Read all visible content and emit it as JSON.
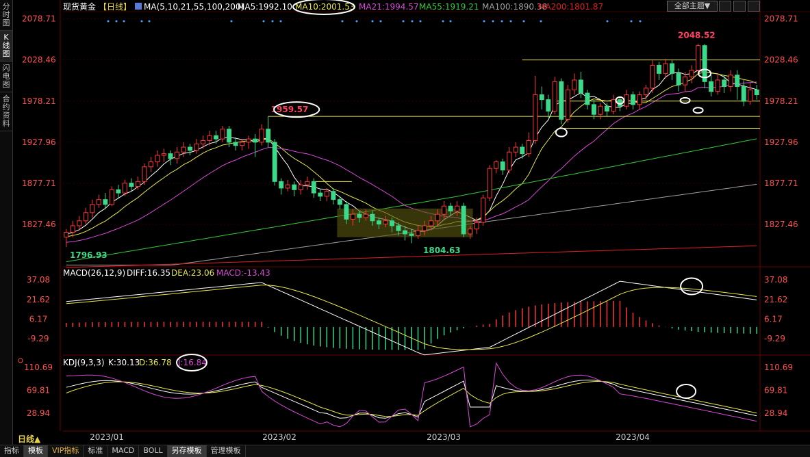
{
  "sidebar": {
    "tabs": [
      {
        "label": "分时图",
        "active": false
      },
      {
        "label": "K线图",
        "active": true
      },
      {
        "label": "闪电图",
        "active": false
      },
      {
        "label": "合约资料",
        "active": false
      }
    ]
  },
  "header": {
    "symbol": "现货黄金",
    "period_tag": "【日线】",
    "ma_params": "MA(5,10,21,55,100,200)",
    "ma5": "MA5:1992.10",
    "ma10": "MA10:2001.53",
    "ma21": "MA21:1994.57",
    "ma55": "MA55:1919.21",
    "ma100": "MA100:1890.38",
    "ma200": "MA200:1801.87",
    "theme_select": "全部主题▼"
  },
  "colors": {
    "up": "#ff3b3b",
    "down": "#3dd98a",
    "ma5": "#ffffff",
    "ma10": "#e8e84a",
    "ma21": "#d84ad8",
    "ma55": "#3ac83a",
    "ma100": "#a0a0a0",
    "ma200": "#e02020",
    "price_axis": "#ff5050",
    "grid": "#550000"
  },
  "price_axis": [
    "2078.71",
    "2028.46",
    "1978.21",
    "1927.96",
    "1877.71",
    "1827.46"
  ],
  "annotations": {
    "high_label": "2048.52",
    "peak_label": "1959.57",
    "low_label_1": "1796.93",
    "low_label_2": "1804.63"
  },
  "macd": {
    "title": "MACD(26,12,9)",
    "diff": "DIFF:16.35",
    "dea": "DEA:23.06",
    "macd": "MACD:-13.43",
    "axis": [
      "37.08",
      "21.62",
      "6.17",
      "-9.29"
    ]
  },
  "kdj": {
    "title": "KDJ(9,3,3)",
    "k": "K:30.13",
    "d": "D:36.78",
    "j": "J:16.84",
    "axis": [
      "110.69",
      "69.81",
      "28.94"
    ]
  },
  "x_axis": [
    "2023/01",
    "2023/02",
    "2023/03",
    "2023/04"
  ],
  "period_label": "日线▲",
  "toolbar": [
    {
      "label": "指标",
      "active": false,
      "vip": false
    },
    {
      "label": "模板",
      "active": true,
      "vip": false
    },
    {
      "label": "VIP指标",
      "active": false,
      "vip": true
    },
    {
      "label": "标准",
      "active": false,
      "vip": false
    },
    {
      "label": "MACD",
      "active": false,
      "vip": false
    },
    {
      "label": "BOLL",
      "active": false,
      "vip": false
    },
    {
      "label": "另存模板",
      "active": true,
      "vip": false
    },
    {
      "label": "管理模板",
      "active": false,
      "vip": false
    }
  ],
  "chart_data": {
    "type": "candlestick",
    "title": "现货黄金【日线】",
    "ylim": [
      1780,
      2085
    ],
    "x_labels": [
      "2023/01",
      "2023/02",
      "2023/03",
      "2023/04"
    ],
    "candles": [
      [
        1812,
        1818,
        1800,
        1822
      ],
      [
        1818,
        1826,
        1812,
        1832
      ],
      [
        1826,
        1832,
        1820,
        1838
      ],
      [
        1832,
        1842,
        1828,
        1848
      ],
      [
        1842,
        1852,
        1836,
        1858
      ],
      [
        1852,
        1858,
        1848,
        1864
      ],
      [
        1858,
        1852,
        1846,
        1866
      ],
      [
        1852,
        1870,
        1850,
        1874
      ],
      [
        1870,
        1866,
        1860,
        1876
      ],
      [
        1866,
        1878,
        1862,
        1882
      ],
      [
        1878,
        1874,
        1868,
        1884
      ],
      [
        1874,
        1880,
        1870,
        1886
      ],
      [
        1880,
        1898,
        1876,
        1902
      ],
      [
        1898,
        1904,
        1892,
        1910
      ],
      [
        1904,
        1912,
        1898,
        1918
      ],
      [
        1912,
        1914,
        1904,
        1920
      ],
      [
        1914,
        1908,
        1900,
        1918
      ],
      [
        1908,
        1916,
        1902,
        1922
      ],
      [
        1916,
        1922,
        1910,
        1928
      ],
      [
        1922,
        1918,
        1912,
        1926
      ],
      [
        1918,
        1926,
        1914,
        1932
      ],
      [
        1926,
        1930,
        1920,
        1936
      ],
      [
        1930,
        1936,
        1924,
        1942
      ],
      [
        1936,
        1932,
        1926,
        1942
      ],
      [
        1932,
        1944,
        1928,
        1948
      ],
      [
        1944,
        1928,
        1922,
        1948
      ],
      [
        1928,
        1924,
        1918,
        1934
      ],
      [
        1924,
        1928,
        1918,
        1932
      ],
      [
        1928,
        1932,
        1920,
        1936
      ],
      [
        1932,
        1928,
        1910,
        1938
      ],
      [
        1928,
        1944,
        1924,
        1950
      ],
      [
        1944,
        1928,
        1922,
        1959.57
      ],
      [
        1928,
        1880,
        1875,
        1932
      ],
      [
        1880,
        1872,
        1864,
        1884
      ],
      [
        1872,
        1876,
        1868,
        1882
      ],
      [
        1876,
        1870,
        1862,
        1880
      ],
      [
        1870,
        1876,
        1864,
        1882
      ],
      [
        1876,
        1880,
        1870,
        1886
      ],
      [
        1880,
        1866,
        1860,
        1884
      ],
      [
        1866,
        1862,
        1856,
        1870
      ],
      [
        1862,
        1868,
        1856,
        1872
      ],
      [
        1868,
        1858,
        1852,
        1872
      ],
      [
        1858,
        1852,
        1846,
        1862
      ],
      [
        1852,
        1834,
        1828,
        1856
      ],
      [
        1834,
        1840,
        1826,
        1846
      ],
      [
        1840,
        1836,
        1830,
        1844
      ],
      [
        1836,
        1840,
        1832,
        1846
      ],
      [
        1840,
        1832,
        1826,
        1844
      ],
      [
        1832,
        1828,
        1822,
        1836
      ],
      [
        1828,
        1832,
        1824,
        1838
      ],
      [
        1832,
        1826,
        1818,
        1836
      ],
      [
        1826,
        1820,
        1814,
        1830
      ],
      [
        1820,
        1816,
        1808,
        1826
      ],
      [
        1816,
        1814,
        1804.63,
        1822
      ],
      [
        1814,
        1820,
        1810,
        1826
      ],
      [
        1820,
        1826,
        1814,
        1832
      ],
      [
        1826,
        1832,
        1820,
        1838
      ],
      [
        1832,
        1840,
        1826,
        1846
      ],
      [
        1840,
        1850,
        1834,
        1856
      ],
      [
        1850,
        1844,
        1838,
        1854
      ],
      [
        1844,
        1850,
        1838,
        1856
      ],
      [
        1850,
        1816,
        1812,
        1854
      ],
      [
        1816,
        1822,
        1810,
        1826
      ],
      [
        1822,
        1830,
        1816,
        1836
      ],
      [
        1830,
        1860,
        1826,
        1864
      ],
      [
        1860,
        1896,
        1856,
        1900
      ],
      [
        1896,
        1904,
        1890,
        1906
      ],
      [
        1904,
        1894,
        1888,
        1908
      ],
      [
        1894,
        1916,
        1890,
        1922
      ],
      [
        1916,
        1922,
        1910,
        1928
      ],
      [
        1922,
        1914,
        1908,
        1926
      ],
      [
        1914,
        1930,
        1910,
        1940
      ],
      [
        1930,
        1986,
        1926,
        2009
      ],
      [
        1986,
        1980,
        1968,
        1996
      ],
      [
        1980,
        1966,
        1958,
        1986
      ],
      [
        1966,
        2002,
        1962,
        2008
      ],
      [
        2002,
        1956,
        1950,
        2006
      ],
      [
        1956,
        1992,
        1952,
        1998
      ],
      [
        1992,
        2004,
        1986,
        2012
      ],
      [
        2004,
        1988,
        1982,
        2014
      ],
      [
        1988,
        1974,
        1968,
        1992
      ],
      [
        1974,
        1962,
        1956,
        1980
      ],
      [
        1962,
        1972,
        1956,
        1976
      ],
      [
        1972,
        1966,
        1960,
        1976
      ],
      [
        1966,
        1980,
        1962,
        1986
      ],
      [
        1980,
        1972,
        1966,
        1984
      ],
      [
        1972,
        1986,
        1968,
        1992
      ],
      [
        1986,
        1974,
        1968,
        1990
      ],
      [
        1974,
        1986,
        1968,
        1990
      ],
      [
        1986,
        1994,
        1980,
        1998
      ],
      [
        1994,
        2022,
        1988,
        2028
      ],
      [
        2022,
        2012,
        2004,
        2026
      ],
      [
        2012,
        2024,
        2006,
        2030
      ],
      [
        2024,
        2012,
        2004,
        2028
      ],
      [
        2012,
        1998,
        1990,
        2018
      ],
      [
        1998,
        2008,
        1990,
        2014
      ],
      [
        2008,
        2016,
        2000,
        2022
      ],
      [
        2016,
        2046,
        2010,
        2048.52
      ],
      [
        2046,
        2002,
        1994,
        2048
      ],
      [
        2002,
        1990,
        1984,
        2010
      ],
      [
        1990,
        2004,
        1986,
        2012
      ],
      [
        2004,
        1996,
        1988,
        2010
      ],
      [
        1996,
        2010,
        1990,
        2016
      ],
      [
        2010,
        1996,
        1980,
        2016
      ],
      [
        1996,
        1978,
        1972,
        2004
      ],
      [
        1978,
        1992,
        1974,
        2000
      ],
      [
        1992,
        1986,
        1980,
        1998
      ]
    ]
  }
}
